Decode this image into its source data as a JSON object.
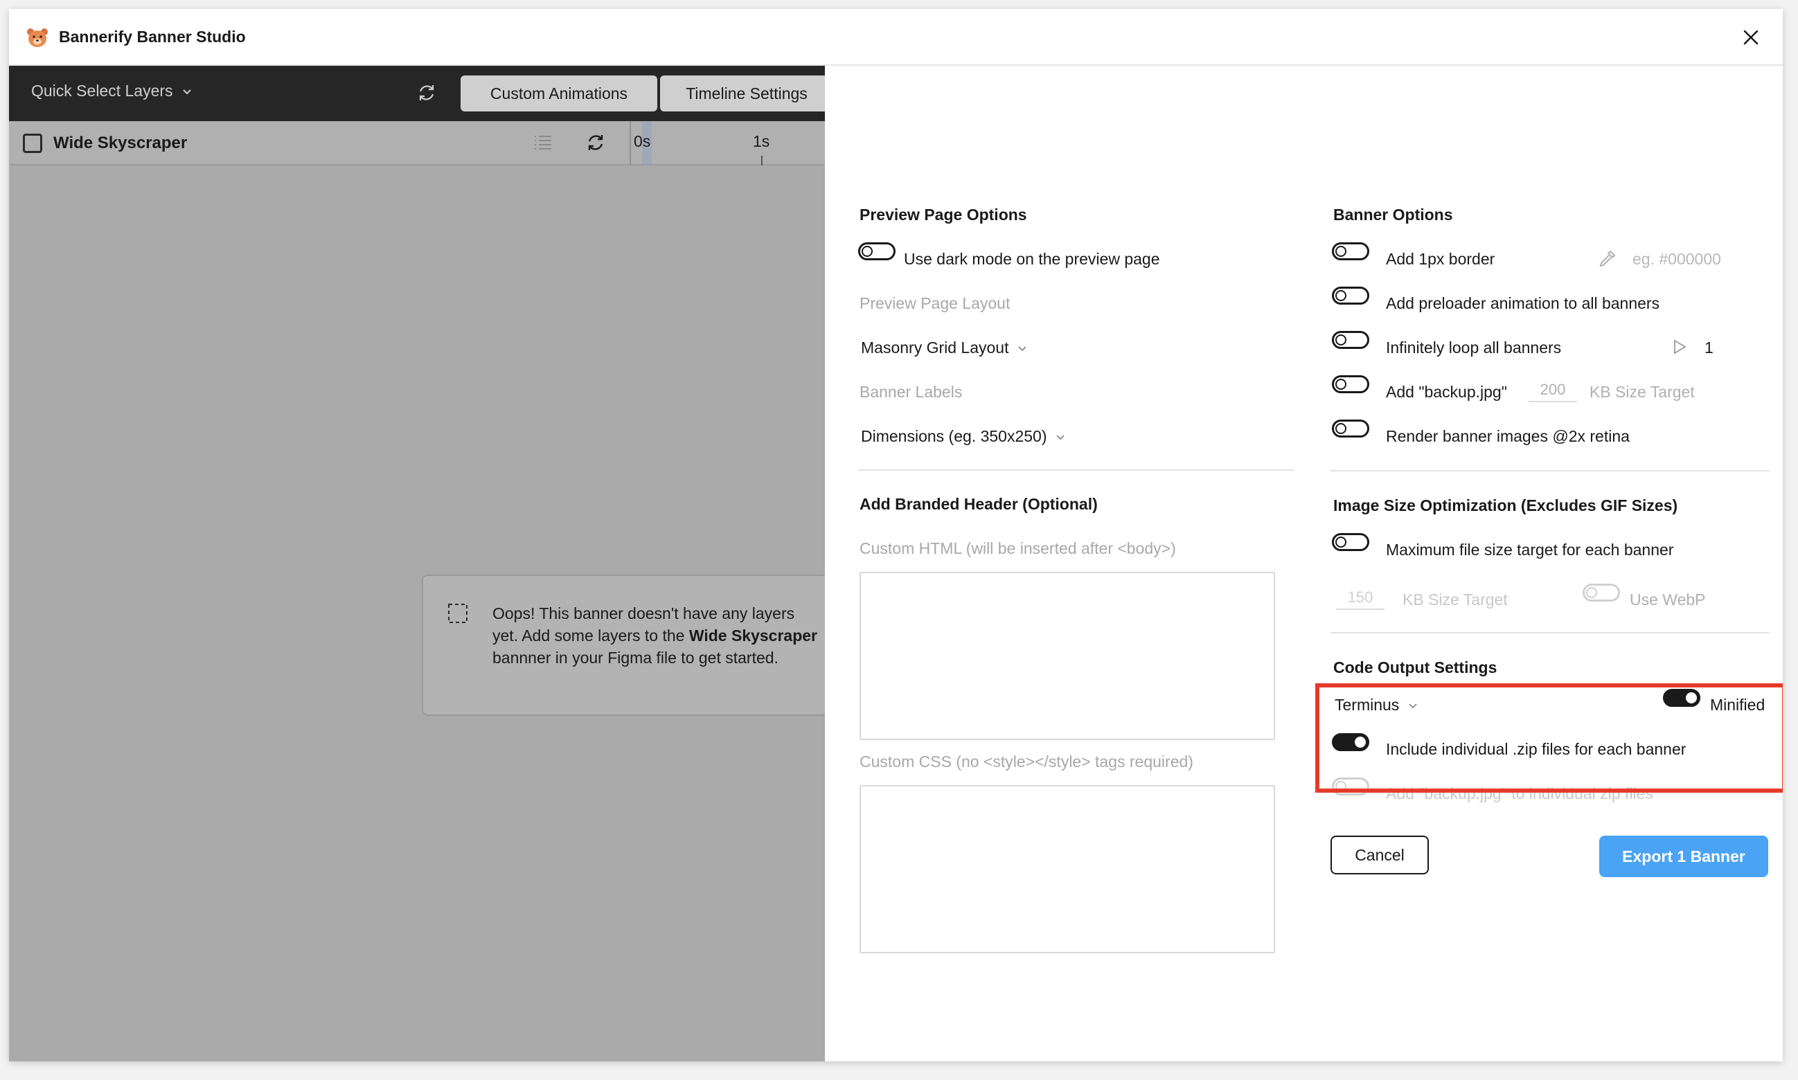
{
  "window": {
    "title": "Bannerify Banner Studio",
    "logo_icon": "bear-logo-icon",
    "close_icon": "close-icon"
  },
  "toolbar": {
    "quick_select_label": "Quick Select Layers",
    "refresh_icon": "refresh-icon",
    "custom_animations_label": "Custom Animations",
    "timeline_settings_label": "Timeline Settings"
  },
  "layer": {
    "name": "Wide Skyscraper",
    "checked": false,
    "timeline_start": "0s",
    "timeline_tick": "1s"
  },
  "empty_state": {
    "icon": "dashed-frame-icon",
    "text_before": "Oops! This banner doesn't have any layers yet. Add some layers to the ",
    "text_bold": "Wide Skyscraper",
    "text_after": " bannner in your Figma file to get started."
  },
  "preview_options": {
    "title": "Preview Page Options",
    "dark_mode_label": "Use dark mode on the preview page",
    "dark_mode_on": false,
    "layout_label": "Preview Page Layout",
    "layout_value": "Masonry Grid Layout",
    "banner_labels_label": "Banner Labels",
    "banner_labels_value": "Dimensions (eg. 350x250)"
  },
  "branded_header": {
    "title": "Add Branded Header (Optional)",
    "html_label": "Custom HTML (will be inserted after <body>)",
    "css_label": "Custom CSS (no <style></style> tags required)",
    "html_value": "",
    "css_value": ""
  },
  "banner_options": {
    "title": "Banner Options",
    "border_label": "Add 1px border",
    "border_color_placeholder": "eg. #000000",
    "eyedropper_icon": "eyedropper-icon",
    "preloader_label": "Add preloader animation to all banners",
    "loop_label": "Infinitely loop all banners",
    "play_icon": "play-icon",
    "loop_count": "1",
    "backup_label": "Add \"backup.jpg\"",
    "backup_size": "200",
    "backup_size_unit": "KB Size Target",
    "retina_label": "Render banner images @2x retina"
  },
  "image_optimization": {
    "title": "Image Size Optimization (Excludes GIF Sizes)",
    "max_size_label": "Maximum file size target for each banner",
    "size_value": "150",
    "size_unit": "KB Size Target",
    "webp_label": "Use WebP"
  },
  "code_output": {
    "title": "Code Output Settings",
    "format_value": "Terminus",
    "minified_label": "Minified",
    "minified_on": true,
    "zip_label": "Include individual .zip files for each banner",
    "zip_on": true,
    "backup_zip_label": "Add \"backup.jpg\" to individual zip files",
    "backup_zip_on": false
  },
  "actions": {
    "cancel_label": "Cancel",
    "export_label": "Export 1 Banner"
  },
  "colors": {
    "toolbar_bg": "#262626",
    "canvas_bg": "#aaaaaa",
    "accent_blue": "#4aa3f5",
    "highlight_red": "#e53b2a"
  }
}
